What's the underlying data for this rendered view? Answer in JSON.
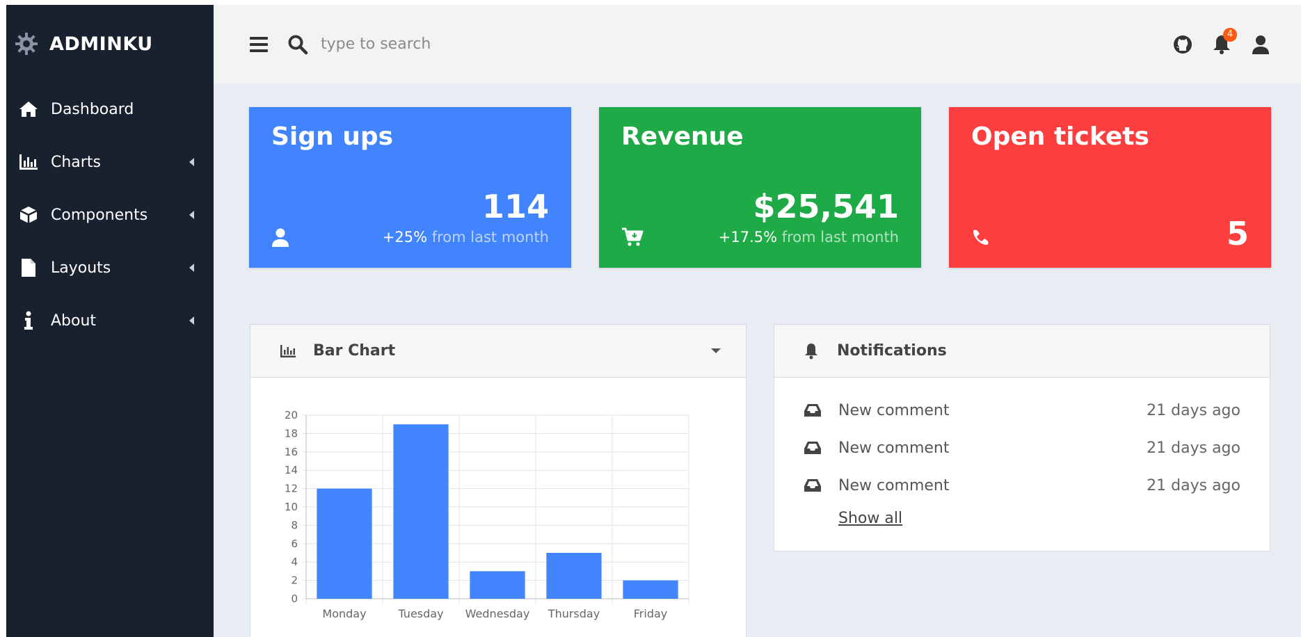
{
  "brand": {
    "name": "ADMINKU"
  },
  "sidebar": {
    "items": [
      {
        "label": "Dashboard",
        "icon": "home-icon"
      },
      {
        "label": "Charts",
        "icon": "bar-chart-icon"
      },
      {
        "label": "Components",
        "icon": "cube-icon"
      },
      {
        "label": "Layouts",
        "icon": "file-icon"
      },
      {
        "label": "About",
        "icon": "info-icon"
      }
    ]
  },
  "topbar": {
    "search_placeholder": "type to search",
    "notification_count": "4"
  },
  "cards": [
    {
      "title": "Sign ups",
      "value": "114",
      "change": "+25%",
      "change_suffix": " from last month",
      "color": "#4184fd"
    },
    {
      "title": "Revenue",
      "value": "$25,541",
      "change": "+17.5%",
      "change_suffix": " from last month",
      "color": "#1faa48"
    },
    {
      "title": "Open tickets",
      "value": "5",
      "color": "#fd3e3e"
    }
  ],
  "bar_panel": {
    "title": "Bar Chart"
  },
  "chart_data": {
    "type": "bar",
    "categories": [
      "Monday",
      "Tuesday",
      "Wednesday",
      "Thursday",
      "Friday"
    ],
    "values": [
      12,
      19,
      3,
      5,
      2
    ],
    "ylim": [
      0,
      20
    ],
    "yticks": [
      0,
      2,
      4,
      6,
      8,
      10,
      12,
      14,
      16,
      18,
      20
    ],
    "color": "#4184fd",
    "grid": true
  },
  "notifications": {
    "title": "Notifications",
    "items": [
      {
        "text": "New comment",
        "time": "21 days ago"
      },
      {
        "text": "New comment",
        "time": "21 days ago"
      },
      {
        "text": "New comment",
        "time": "21 days ago"
      }
    ],
    "show_all": "Show all"
  }
}
